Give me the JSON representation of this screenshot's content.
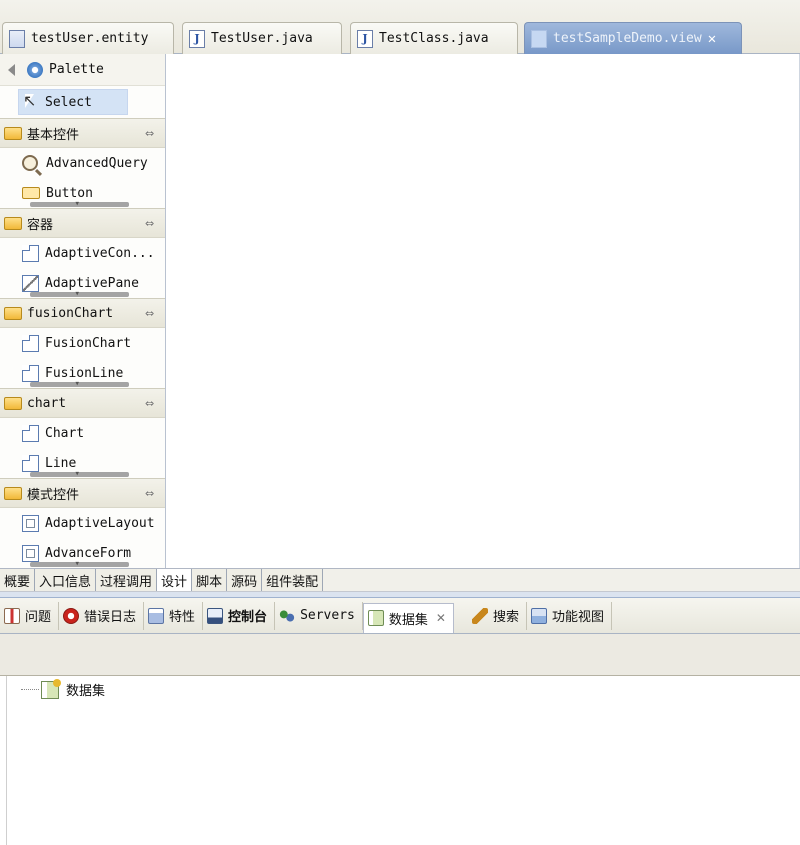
{
  "editor_tabs": [
    {
      "label": "testUser.entity",
      "icon": "entity-file-icon",
      "active": false
    },
    {
      "label": "TestUser.java",
      "icon": "java-file-icon",
      "active": false
    },
    {
      "label": "TestClass.java",
      "icon": "java-file-icon",
      "active": false
    },
    {
      "label": "testSampleDemo.view",
      "icon": "view-file-icon",
      "active": true
    }
  ],
  "palette": {
    "title": "Palette",
    "select_label": "Select",
    "groups": [
      {
        "title": "基本控件",
        "items": [
          "AdvancedQuery",
          "Button"
        ]
      },
      {
        "title": "容器",
        "items": [
          "AdaptiveCon...",
          "AdaptivePane"
        ]
      },
      {
        "title": "fusionChart",
        "items": [
          "FusionChart",
          "FusionLine"
        ]
      },
      {
        "title": "chart",
        "items": [
          "Chart",
          "Line"
        ]
      },
      {
        "title": "模式控件",
        "items": [
          "AdaptiveLayout",
          "AdvanceForm"
        ]
      }
    ]
  },
  "bottom_tabs": [
    "概要",
    "入口信息",
    "过程调用",
    "设计",
    "脚本",
    "源码",
    "组件装配"
  ],
  "view_tabs": [
    {
      "label": "问题",
      "icon": "problems-icon"
    },
    {
      "label": "错误日志",
      "icon": "error-log-icon"
    },
    {
      "label": "特性",
      "icon": "properties-icon"
    },
    {
      "label": "控制台",
      "icon": "console-icon"
    },
    {
      "label": "Servers",
      "icon": "servers-icon"
    },
    {
      "label": "数据集",
      "icon": "dataset-icon"
    },
    {
      "label": "搜索",
      "icon": "search-icon"
    },
    {
      "label": "功能视图",
      "icon": "function-view-icon"
    }
  ],
  "tree": {
    "root_label": "数据集"
  }
}
